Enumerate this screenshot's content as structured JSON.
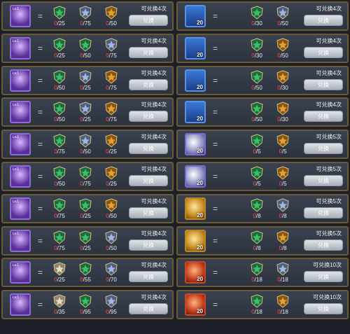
{
  "left": [
    {
      "portrait": "purple",
      "lv": "Lv.1",
      "count": "",
      "costs": [
        {
          "badge": "green",
          "amt": "0/25"
        },
        {
          "badge": "silver",
          "amt": "0/75"
        },
        {
          "badge": "gold",
          "amt": "0/50"
        }
      ],
      "limit": "可兑换4次",
      "button": "兑换"
    },
    {
      "portrait": "purple",
      "lv": "Lv.1",
      "count": "",
      "costs": [
        {
          "badge": "green",
          "amt": "0/25"
        },
        {
          "badge": "green",
          "amt": "0/50"
        },
        {
          "badge": "silver",
          "amt": "0/75"
        }
      ],
      "limit": "可兑换4次",
      "button": "兑换"
    },
    {
      "portrait": "purple",
      "lv": "Lv.1",
      "count": "",
      "costs": [
        {
          "badge": "green",
          "amt": "0/50"
        },
        {
          "badge": "silver",
          "amt": "0/25"
        },
        {
          "badge": "gold",
          "amt": "0/75"
        }
      ],
      "limit": "可兑换4次",
      "button": "兑换"
    },
    {
      "portrait": "purple",
      "lv": "Lv.1",
      "count": "",
      "costs": [
        {
          "badge": "green",
          "amt": "0/50"
        },
        {
          "badge": "silver",
          "amt": "0/25"
        },
        {
          "badge": "gold",
          "amt": "0/75"
        }
      ],
      "limit": "可兑换4次",
      "button": "兑换"
    },
    {
      "portrait": "purple",
      "lv": "Lv.1",
      "count": "",
      "costs": [
        {
          "badge": "green",
          "amt": "0/75"
        },
        {
          "badge": "silver",
          "amt": "0/50"
        },
        {
          "badge": "gold",
          "amt": "0/25"
        }
      ],
      "limit": "可兑换4次",
      "button": "兑换"
    },
    {
      "portrait": "purple",
      "lv": "Lv.1",
      "count": "",
      "costs": [
        {
          "badge": "green",
          "amt": "0/50"
        },
        {
          "badge": "green",
          "amt": "0/75"
        },
        {
          "badge": "gold",
          "amt": "0/25"
        }
      ],
      "limit": "可兑换4次",
      "button": "兑换"
    },
    {
      "portrait": "purple",
      "lv": "Lv.1",
      "count": "",
      "costs": [
        {
          "badge": "green",
          "amt": "0/75"
        },
        {
          "badge": "green",
          "amt": "0/25"
        },
        {
          "badge": "gold",
          "amt": "0/50"
        }
      ],
      "limit": "可兑换4次",
      "button": "兑换"
    },
    {
      "portrait": "purple",
      "lv": "Lv.1",
      "count": "",
      "costs": [
        {
          "badge": "green",
          "amt": "0/75"
        },
        {
          "badge": "green",
          "amt": "0/25"
        },
        {
          "badge": "silver",
          "amt": "0/50"
        }
      ],
      "limit": "可兑换4次",
      "button": "兑换"
    },
    {
      "portrait": "purple",
      "lv": "Lv.1",
      "count": "",
      "costs": [
        {
          "badge": "white",
          "amt": "0/25"
        },
        {
          "badge": "green",
          "amt": "0/55"
        },
        {
          "badge": "silver",
          "amt": "0/70"
        }
      ],
      "limit": "可兑换4次",
      "button": "兑换"
    },
    {
      "portrait": "purple",
      "lv": "Lv.1",
      "count": "",
      "costs": [
        {
          "badge": "white",
          "amt": "0/35"
        },
        {
          "badge": "green",
          "amt": "0/95"
        },
        {
          "badge": "silver",
          "amt": "0/95"
        }
      ],
      "limit": "可兑换4次",
      "button": "兑换"
    }
  ],
  "right": [
    {
      "portrait": "card",
      "lv": "",
      "count": "20",
      "costs": [
        {
          "badge": "green",
          "amt": "0/30"
        },
        {
          "badge": "silver",
          "amt": "0/50"
        }
      ],
      "limit": "可兑换4次",
      "button": "兑换"
    },
    {
      "portrait": "card",
      "lv": "",
      "count": "20",
      "costs": [
        {
          "badge": "green",
          "amt": "0/30"
        },
        {
          "badge": "gold",
          "amt": "0/50"
        }
      ],
      "limit": "可兑换4次",
      "button": "兑换"
    },
    {
      "portrait": "card",
      "lv": "",
      "count": "20",
      "costs": [
        {
          "badge": "green",
          "amt": "0/50"
        },
        {
          "badge": "gold",
          "amt": "0/30"
        }
      ],
      "limit": "可兑换4次",
      "button": "兑换"
    },
    {
      "portrait": "card",
      "lv": "",
      "count": "20",
      "costs": [
        {
          "badge": "green",
          "amt": "0/50"
        },
        {
          "badge": "gold",
          "amt": "0/30"
        }
      ],
      "limit": "可兑换4次",
      "button": "兑换"
    },
    {
      "portrait": "silver",
      "lv": "",
      "count": "20",
      "costs": [
        {
          "badge": "green",
          "amt": "0/5"
        },
        {
          "badge": "gold",
          "amt": "0/5"
        }
      ],
      "limit": "可兑换5次",
      "button": "兑换"
    },
    {
      "portrait": "silver",
      "lv": "",
      "count": "20",
      "costs": [
        {
          "badge": "green",
          "amt": "0/5"
        },
        {
          "badge": "gold",
          "amt": "0/5"
        }
      ],
      "limit": "可兑换5次",
      "button": "兑换"
    },
    {
      "portrait": "gold",
      "lv": "",
      "count": "20",
      "costs": [
        {
          "badge": "green",
          "amt": "0/8"
        },
        {
          "badge": "silver",
          "amt": "0/8"
        }
      ],
      "limit": "可兑换5次",
      "button": "兑换"
    },
    {
      "portrait": "gold",
      "lv": "",
      "count": "20",
      "costs": [
        {
          "badge": "green",
          "amt": "0/8"
        },
        {
          "badge": "gold",
          "amt": "0/8"
        }
      ],
      "limit": "可兑换5次",
      "button": "兑换"
    },
    {
      "portrait": "red",
      "lv": "",
      "count": "20",
      "costs": [
        {
          "badge": "green",
          "amt": "0/18"
        },
        {
          "badge": "silver",
          "amt": "0/18"
        }
      ],
      "limit": "可兑换10次",
      "button": "兑换"
    },
    {
      "portrait": "red",
      "lv": "",
      "count": "20",
      "costs": [
        {
          "badge": "green",
          "amt": "0/18"
        },
        {
          "badge": "gold",
          "amt": "0/18"
        }
      ],
      "limit": "可兑换10次",
      "button": "兑换"
    }
  ],
  "colors": {
    "green_badge": "#3bbf6a",
    "silver_badge": "#a6b6d6",
    "gold_badge": "#e0a33a",
    "white_badge": "#e6dcc4",
    "frame": "#6b5a35",
    "zero": "#ff4b4b"
  },
  "icons": {
    "equals": "=",
    "badge": "shield-star-icon"
  }
}
